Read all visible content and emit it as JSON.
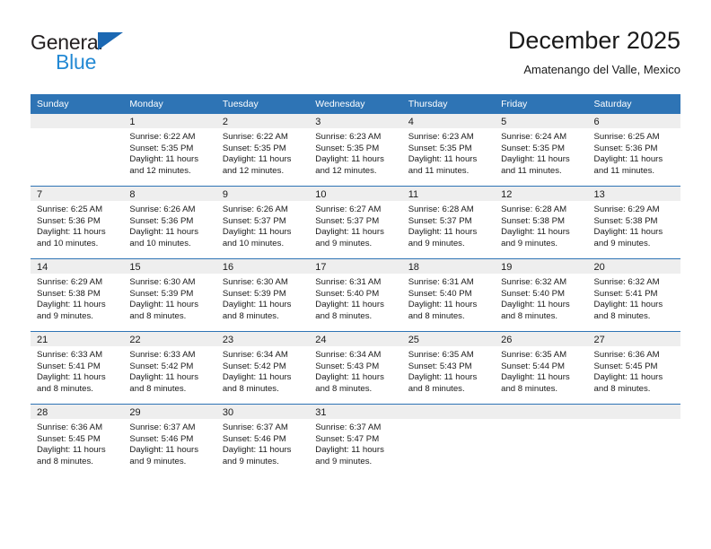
{
  "brand": {
    "name_top": "General",
    "name_bottom": "Blue",
    "triangle_color": "#1b68b3",
    "text_color_top": "#231f20",
    "text_color_bottom": "#2389d4"
  },
  "header": {
    "title": "December 2025",
    "subtitle": "Amatenango del Valle, Mexico"
  },
  "theme": {
    "header_row_bg": "#2e74b5",
    "header_row_text": "#ffffff",
    "daynum_band_bg": "#eeeeee",
    "grid_line": "#2e74b5",
    "page_bg": "#ffffff"
  },
  "weekday_headers": [
    "Sunday",
    "Monday",
    "Tuesday",
    "Wednesday",
    "Thursday",
    "Friday",
    "Saturday"
  ],
  "labels": {
    "sunrise_prefix": "Sunrise:",
    "sunset_prefix": "Sunset:",
    "daylight_prefix": "Daylight:"
  },
  "weeks": [
    [
      {
        "day": "",
        "empty": true,
        "l1": "",
        "l2": "",
        "l3": "",
        "l4": ""
      },
      {
        "day": "1",
        "empty": false,
        "l1": "Sunrise: 6:22 AM",
        "l2": "Sunset: 5:35 PM",
        "l3": "Daylight: 11 hours",
        "l4": "and 12 minutes."
      },
      {
        "day": "2",
        "empty": false,
        "l1": "Sunrise: 6:22 AM",
        "l2": "Sunset: 5:35 PM",
        "l3": "Daylight: 11 hours",
        "l4": "and 12 minutes."
      },
      {
        "day": "3",
        "empty": false,
        "l1": "Sunrise: 6:23 AM",
        "l2": "Sunset: 5:35 PM",
        "l3": "Daylight: 11 hours",
        "l4": "and 12 minutes."
      },
      {
        "day": "4",
        "empty": false,
        "l1": "Sunrise: 6:23 AM",
        "l2": "Sunset: 5:35 PM",
        "l3": "Daylight: 11 hours",
        "l4": "and 11 minutes."
      },
      {
        "day": "5",
        "empty": false,
        "l1": "Sunrise: 6:24 AM",
        "l2": "Sunset: 5:35 PM",
        "l3": "Daylight: 11 hours",
        "l4": "and 11 minutes."
      },
      {
        "day": "6",
        "empty": false,
        "l1": "Sunrise: 6:25 AM",
        "l2": "Sunset: 5:36 PM",
        "l3": "Daylight: 11 hours",
        "l4": "and 11 minutes."
      }
    ],
    [
      {
        "day": "7",
        "empty": false,
        "l1": "Sunrise: 6:25 AM",
        "l2": "Sunset: 5:36 PM",
        "l3": "Daylight: 11 hours",
        "l4": "and 10 minutes."
      },
      {
        "day": "8",
        "empty": false,
        "l1": "Sunrise: 6:26 AM",
        "l2": "Sunset: 5:36 PM",
        "l3": "Daylight: 11 hours",
        "l4": "and 10 minutes."
      },
      {
        "day": "9",
        "empty": false,
        "l1": "Sunrise: 6:26 AM",
        "l2": "Sunset: 5:37 PM",
        "l3": "Daylight: 11 hours",
        "l4": "and 10 minutes."
      },
      {
        "day": "10",
        "empty": false,
        "l1": "Sunrise: 6:27 AM",
        "l2": "Sunset: 5:37 PM",
        "l3": "Daylight: 11 hours",
        "l4": "and 9 minutes."
      },
      {
        "day": "11",
        "empty": false,
        "l1": "Sunrise: 6:28 AM",
        "l2": "Sunset: 5:37 PM",
        "l3": "Daylight: 11 hours",
        "l4": "and 9 minutes."
      },
      {
        "day": "12",
        "empty": false,
        "l1": "Sunrise: 6:28 AM",
        "l2": "Sunset: 5:38 PM",
        "l3": "Daylight: 11 hours",
        "l4": "and 9 minutes."
      },
      {
        "day": "13",
        "empty": false,
        "l1": "Sunrise: 6:29 AM",
        "l2": "Sunset: 5:38 PM",
        "l3": "Daylight: 11 hours",
        "l4": "and 9 minutes."
      }
    ],
    [
      {
        "day": "14",
        "empty": false,
        "l1": "Sunrise: 6:29 AM",
        "l2": "Sunset: 5:38 PM",
        "l3": "Daylight: 11 hours",
        "l4": "and 9 minutes."
      },
      {
        "day": "15",
        "empty": false,
        "l1": "Sunrise: 6:30 AM",
        "l2": "Sunset: 5:39 PM",
        "l3": "Daylight: 11 hours",
        "l4": "and 8 minutes."
      },
      {
        "day": "16",
        "empty": false,
        "l1": "Sunrise: 6:30 AM",
        "l2": "Sunset: 5:39 PM",
        "l3": "Daylight: 11 hours",
        "l4": "and 8 minutes."
      },
      {
        "day": "17",
        "empty": false,
        "l1": "Sunrise: 6:31 AM",
        "l2": "Sunset: 5:40 PM",
        "l3": "Daylight: 11 hours",
        "l4": "and 8 minutes."
      },
      {
        "day": "18",
        "empty": false,
        "l1": "Sunrise: 6:31 AM",
        "l2": "Sunset: 5:40 PM",
        "l3": "Daylight: 11 hours",
        "l4": "and 8 minutes."
      },
      {
        "day": "19",
        "empty": false,
        "l1": "Sunrise: 6:32 AM",
        "l2": "Sunset: 5:40 PM",
        "l3": "Daylight: 11 hours",
        "l4": "and 8 minutes."
      },
      {
        "day": "20",
        "empty": false,
        "l1": "Sunrise: 6:32 AM",
        "l2": "Sunset: 5:41 PM",
        "l3": "Daylight: 11 hours",
        "l4": "and 8 minutes."
      }
    ],
    [
      {
        "day": "21",
        "empty": false,
        "l1": "Sunrise: 6:33 AM",
        "l2": "Sunset: 5:41 PM",
        "l3": "Daylight: 11 hours",
        "l4": "and 8 minutes."
      },
      {
        "day": "22",
        "empty": false,
        "l1": "Sunrise: 6:33 AM",
        "l2": "Sunset: 5:42 PM",
        "l3": "Daylight: 11 hours",
        "l4": "and 8 minutes."
      },
      {
        "day": "23",
        "empty": false,
        "l1": "Sunrise: 6:34 AM",
        "l2": "Sunset: 5:42 PM",
        "l3": "Daylight: 11 hours",
        "l4": "and 8 minutes."
      },
      {
        "day": "24",
        "empty": false,
        "l1": "Sunrise: 6:34 AM",
        "l2": "Sunset: 5:43 PM",
        "l3": "Daylight: 11 hours",
        "l4": "and 8 minutes."
      },
      {
        "day": "25",
        "empty": false,
        "l1": "Sunrise: 6:35 AM",
        "l2": "Sunset: 5:43 PM",
        "l3": "Daylight: 11 hours",
        "l4": "and 8 minutes."
      },
      {
        "day": "26",
        "empty": false,
        "l1": "Sunrise: 6:35 AM",
        "l2": "Sunset: 5:44 PM",
        "l3": "Daylight: 11 hours",
        "l4": "and 8 minutes."
      },
      {
        "day": "27",
        "empty": false,
        "l1": "Sunrise: 6:36 AM",
        "l2": "Sunset: 5:45 PM",
        "l3": "Daylight: 11 hours",
        "l4": "and 8 minutes."
      }
    ],
    [
      {
        "day": "28",
        "empty": false,
        "l1": "Sunrise: 6:36 AM",
        "l2": "Sunset: 5:45 PM",
        "l3": "Daylight: 11 hours",
        "l4": "and 8 minutes."
      },
      {
        "day": "29",
        "empty": false,
        "l1": "Sunrise: 6:37 AM",
        "l2": "Sunset: 5:46 PM",
        "l3": "Daylight: 11 hours",
        "l4": "and 9 minutes."
      },
      {
        "day": "30",
        "empty": false,
        "l1": "Sunrise: 6:37 AM",
        "l2": "Sunset: 5:46 PM",
        "l3": "Daylight: 11 hours",
        "l4": "and 9 minutes."
      },
      {
        "day": "31",
        "empty": false,
        "l1": "Sunrise: 6:37 AM",
        "l2": "Sunset: 5:47 PM",
        "l3": "Daylight: 11 hours",
        "l4": "and 9 minutes."
      },
      {
        "day": "",
        "empty": true,
        "l1": "",
        "l2": "",
        "l3": "",
        "l4": ""
      },
      {
        "day": "",
        "empty": true,
        "l1": "",
        "l2": "",
        "l3": "",
        "l4": ""
      },
      {
        "day": "",
        "empty": true,
        "l1": "",
        "l2": "",
        "l3": "",
        "l4": ""
      }
    ]
  ]
}
